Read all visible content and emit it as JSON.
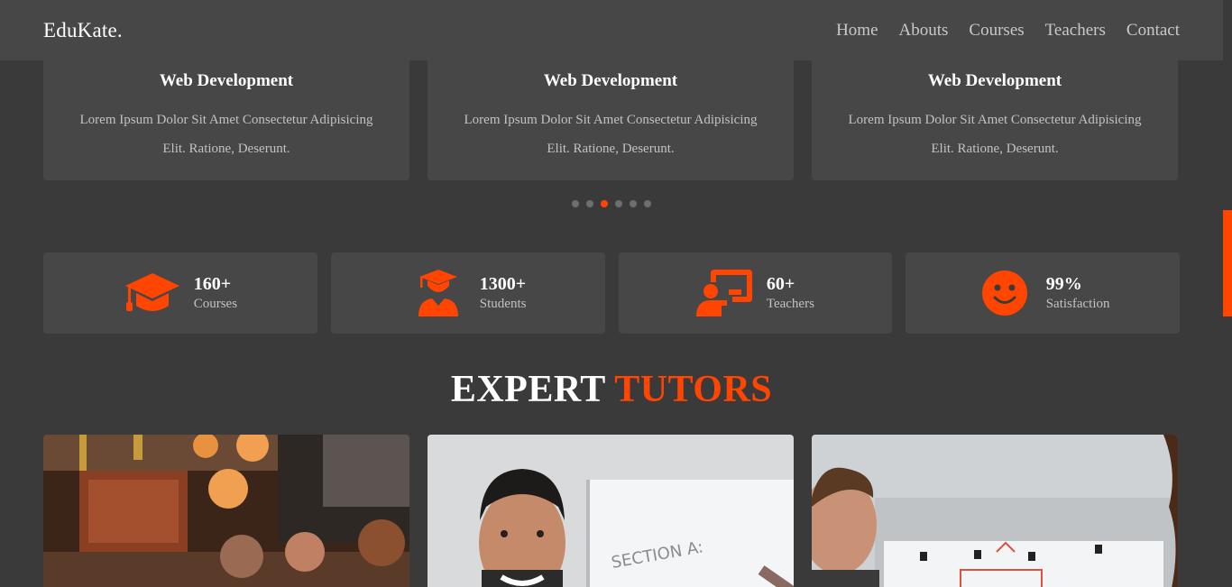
{
  "header": {
    "logo": "EduKate.",
    "nav": [
      "Home",
      "Abouts",
      "Courses",
      "Teachers",
      "Contact"
    ]
  },
  "courses": [
    {
      "title": "Web Development",
      "description": "Lorem Ipsum Dolor Sit Amet Consectetur Adipisicing Elit. Ratione, Deserunt."
    },
    {
      "title": "Web Development",
      "description": "Lorem Ipsum Dolor Sit Amet Consectetur Adipisicing Elit. Ratione, Deserunt."
    },
    {
      "title": "Web Development",
      "description": "Lorem Ipsum Dolor Sit Amet Consectetur Adipisicing Elit. Ratione, Deserunt."
    }
  ],
  "carousel": {
    "total": 6,
    "active_index": 2
  },
  "stats": [
    {
      "icon": "graduation-cap-icon",
      "value": "160+",
      "label": "Courses"
    },
    {
      "icon": "student-icon",
      "value": "1300+",
      "label": "Students"
    },
    {
      "icon": "teacher-icon",
      "value": "60+",
      "label": "Teachers"
    },
    {
      "icon": "smile-icon",
      "value": "99%",
      "label": "Satisfaction"
    }
  ],
  "tutors_section": {
    "title_white": "EXPERT",
    "title_orange": "TUTORS"
  },
  "colors": {
    "accent": "#ff4500",
    "background": "#3a3a3a",
    "card": "#474747"
  }
}
